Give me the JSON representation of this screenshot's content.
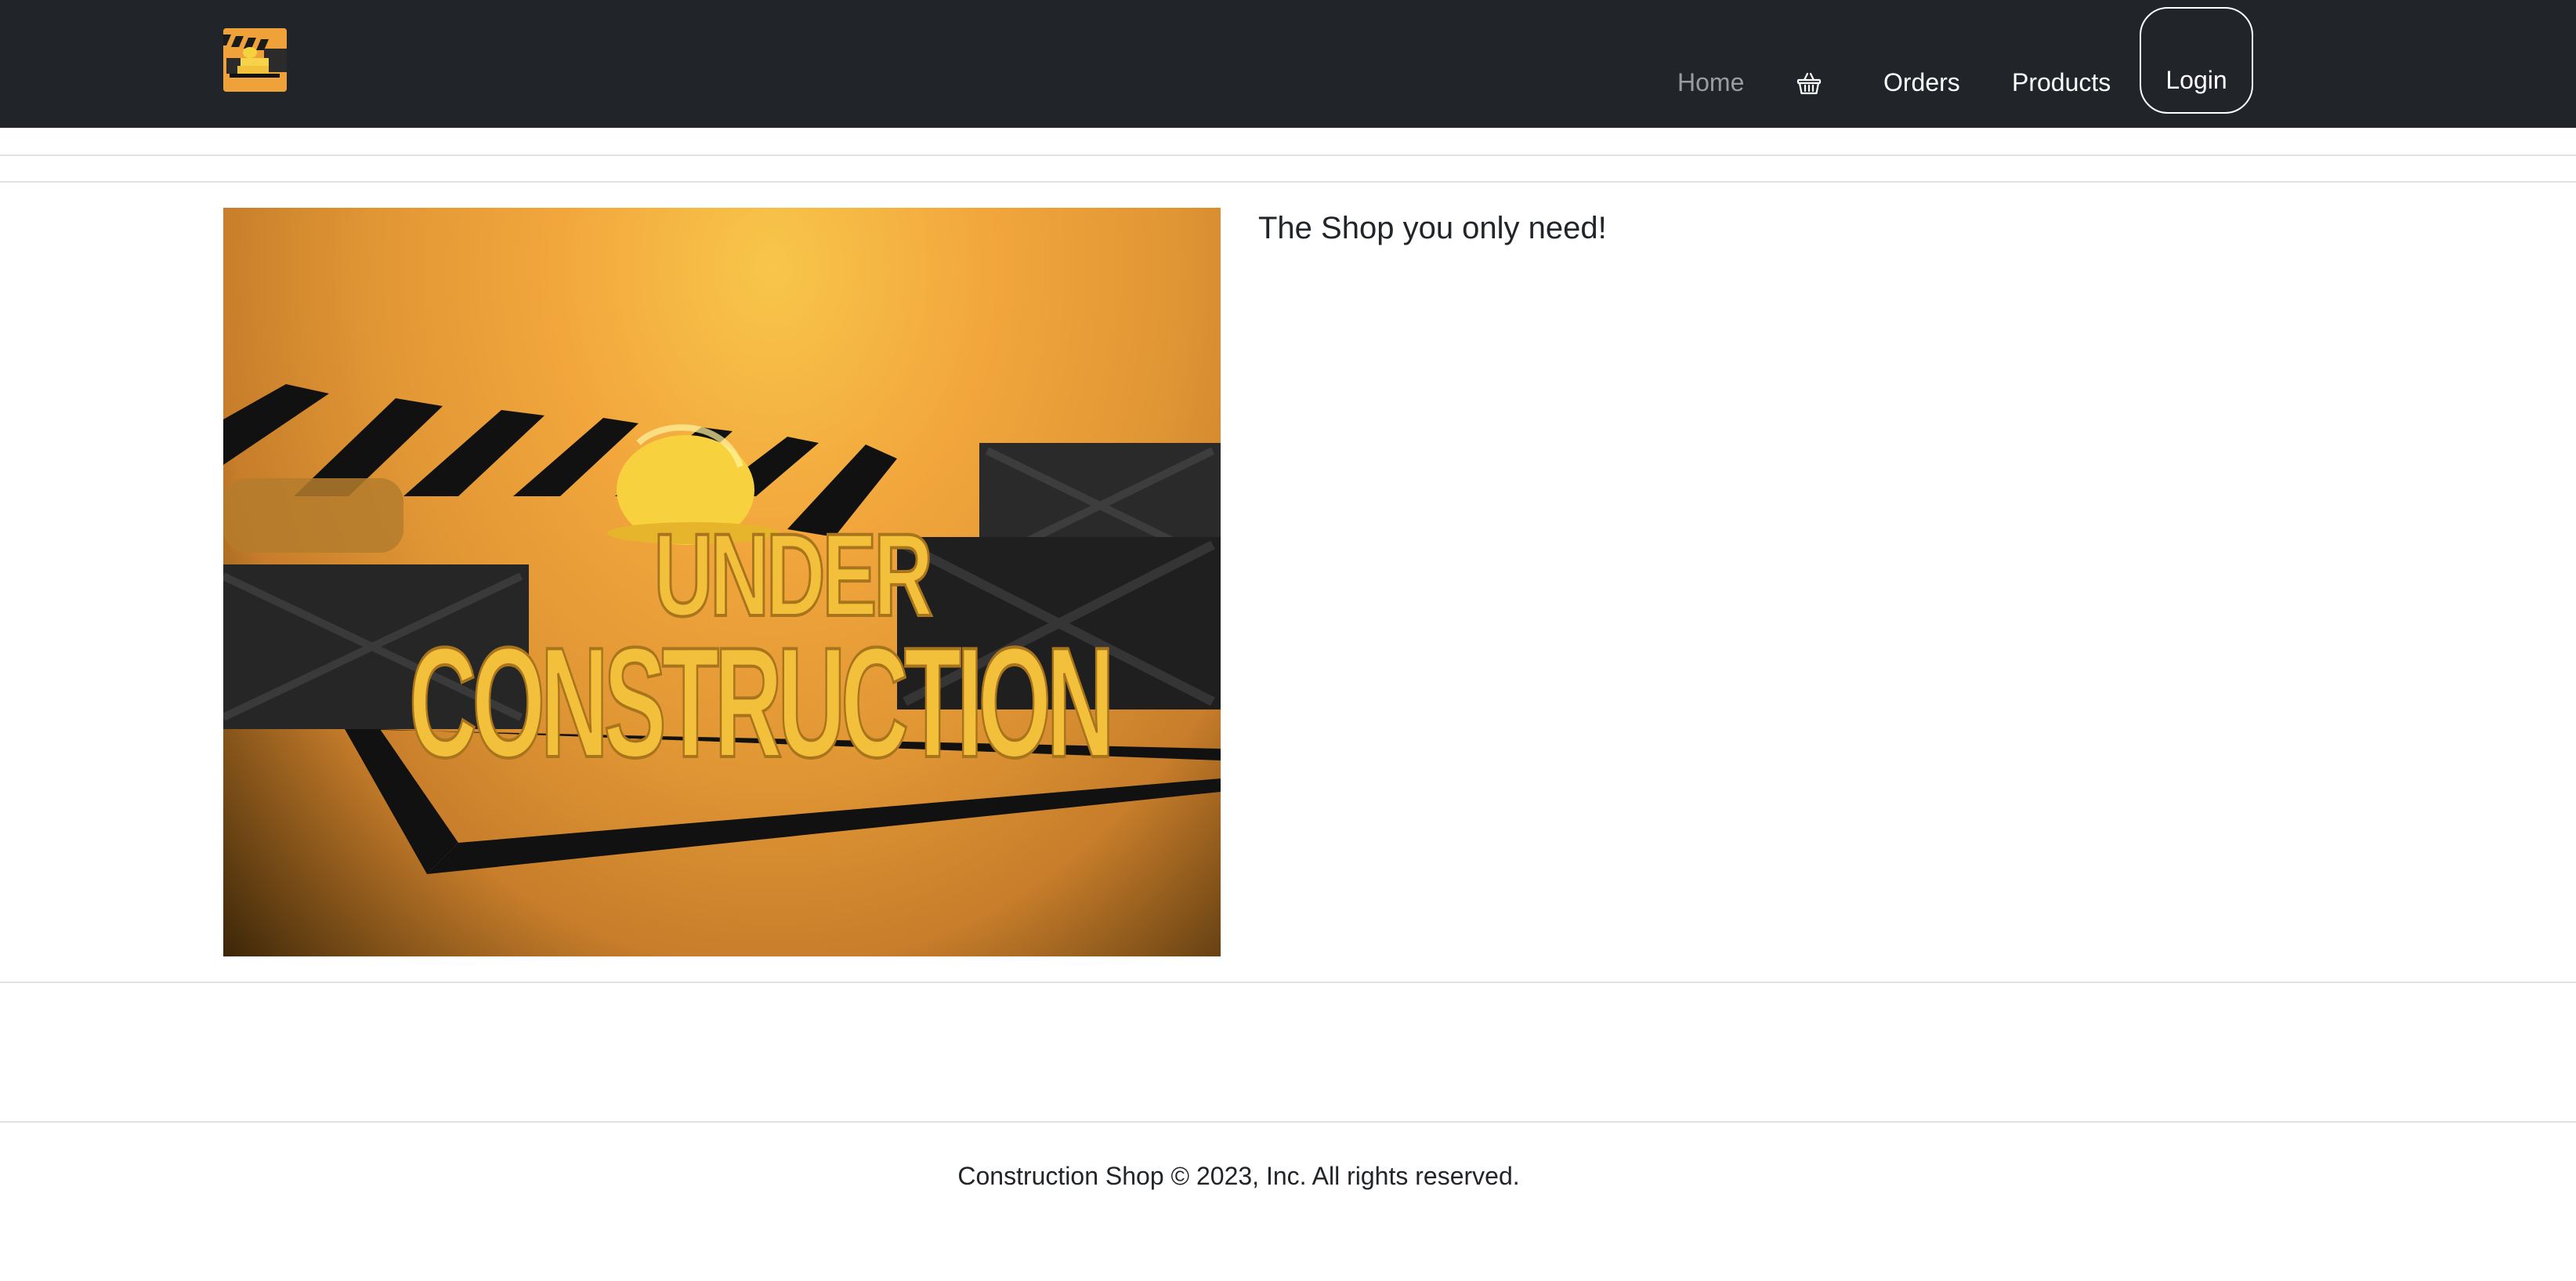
{
  "navbar": {
    "logo_icon": "construction-logo-icon",
    "links": {
      "home": "Home",
      "orders": "Orders",
      "products": "Products"
    },
    "cart_icon": "basket-icon",
    "login_label": "Login"
  },
  "hero": {
    "image_icon": "under-construction-image",
    "title": "The Shop you only need!"
  },
  "footer": {
    "text": "Construction Shop © 2023, Inc. All rights reserved."
  },
  "colors": {
    "navbar_bg": "#212529",
    "accent": "#f2a63c"
  }
}
